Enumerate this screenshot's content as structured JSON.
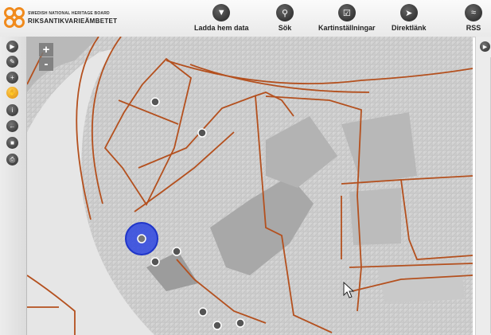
{
  "header": {
    "logo_small": "SWEDISH NATIONAL HERITAGE BOARD",
    "logo_big": "RIKSANTIKVARIEÄMBETET"
  },
  "toolbar": [
    {
      "label": "Ladda hem data",
      "icon": "download-icon"
    },
    {
      "label": "Sök",
      "icon": "search-icon"
    },
    {
      "label": "Kartinställningar",
      "icon": "map-settings-icon"
    },
    {
      "label": "Direktlänk",
      "icon": "direct-link-icon"
    },
    {
      "label": "RSS",
      "icon": "rss-icon"
    }
  ],
  "sidebar": [
    {
      "name": "expand-panel-button",
      "icon": "play-icon"
    },
    {
      "name": "draw-button",
      "icon": "pencil-icon"
    },
    {
      "name": "zoom-box-button",
      "icon": "magnifier-plus-icon"
    },
    {
      "name": "pan-button",
      "icon": "hand-icon",
      "active": true
    },
    {
      "name": "info-button",
      "icon": "info-icon"
    },
    {
      "name": "back-button",
      "icon": "back-arrow-icon"
    },
    {
      "name": "stop-button",
      "icon": "stop-icon"
    },
    {
      "name": "print-button",
      "icon": "printer-icon"
    }
  ],
  "zoom": {
    "plus": "+",
    "minus": "-"
  },
  "map": {
    "marker_icon": "registry-marker-icon",
    "selected_color": "#1f35c9",
    "boundary_color": "#b4501e"
  },
  "colors": {
    "accent": "#f08a1c",
    "header_bg": "#f2f2f2",
    "active_tool": "#f0a020"
  }
}
